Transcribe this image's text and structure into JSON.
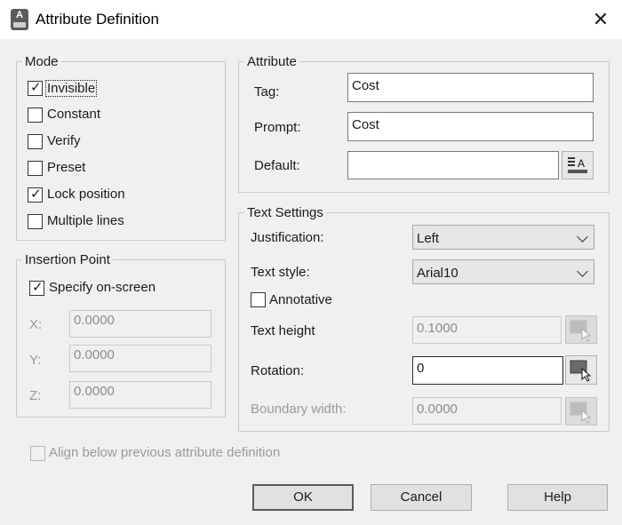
{
  "window": {
    "title": "Attribute Definition",
    "app_icon_letter": "A",
    "close_glyph": "✕"
  },
  "mode": {
    "legend": "Mode",
    "options": [
      {
        "label": "Invisible",
        "checked": true
      },
      {
        "label": "Constant",
        "checked": false
      },
      {
        "label": "Verify",
        "checked": false
      },
      {
        "label": "Preset",
        "checked": false
      },
      {
        "label": "Lock position",
        "checked": true
      },
      {
        "label": "Multiple lines",
        "checked": false
      }
    ]
  },
  "insertion_point": {
    "legend": "Insertion Point",
    "specify_label": "Specify on-screen",
    "specify_checked": true,
    "x_label": "X:",
    "x_value": "0.0000",
    "y_label": "Y:",
    "y_value": "0.0000",
    "z_label": "Z:",
    "z_value": "0.0000"
  },
  "attribute": {
    "legend": "Attribute",
    "tag_label": "Tag:",
    "tag_value": "Cost",
    "prompt_label": "Prompt:",
    "prompt_value": "Cost",
    "default_label": "Default:",
    "default_value": ""
  },
  "text_settings": {
    "legend": "Text Settings",
    "justification_label": "Justification:",
    "justification_value": "Left",
    "text_style_label": "Text style:",
    "text_style_value": "Arial10",
    "annotative_label": "Annotative",
    "annotative_checked": false,
    "text_height_label": "Text height",
    "text_height_value": "0.1000",
    "rotation_label": "Rotation:",
    "rotation_value": "0",
    "boundary_width_label": "Boundary width:",
    "boundary_width_value": "0.0000"
  },
  "align_below": {
    "label": "Align below previous attribute definition",
    "checked": false
  },
  "buttons": {
    "ok": "OK",
    "cancel": "Cancel",
    "help": "Help"
  }
}
